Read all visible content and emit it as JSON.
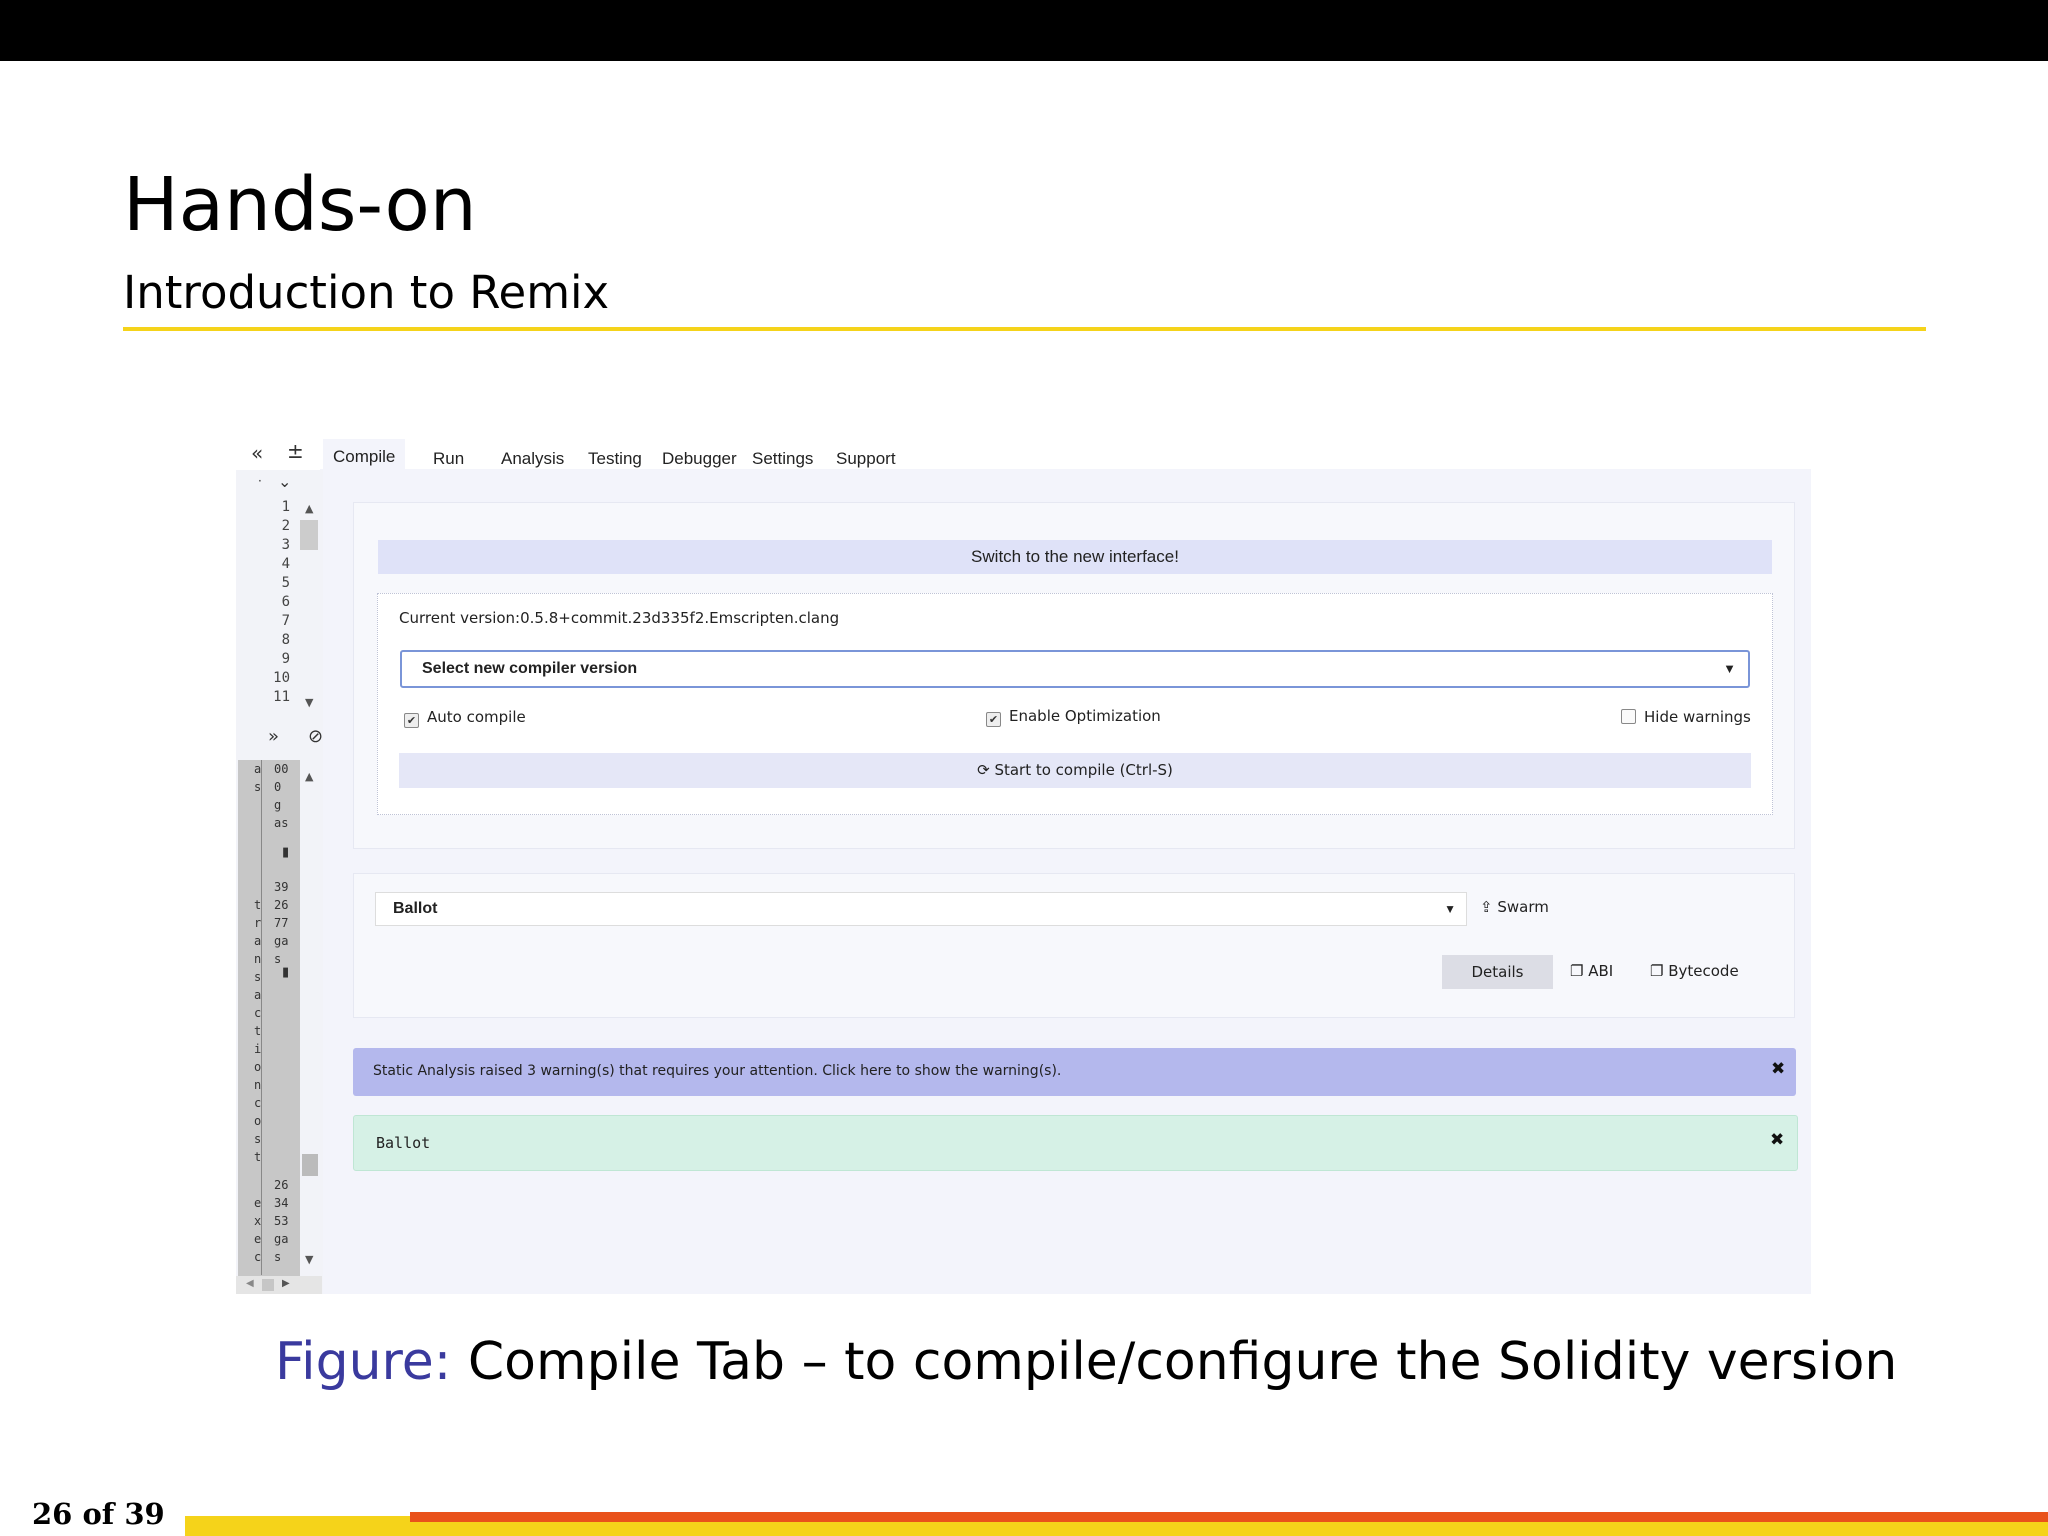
{
  "slide": {
    "title": "Hands-on",
    "subtitle": "Introduction to Remix",
    "caption_label": "Figure:",
    "caption_text": "Compile Tab – to compile/configure the Solidity version",
    "page_number": "26 of 39"
  },
  "remix": {
    "tabs": [
      "Compile",
      "Run",
      "Analysis",
      "Testing",
      "Debugger",
      "Settings",
      "Support"
    ],
    "line_numbers": [
      "1",
      "2",
      "3",
      "4",
      "5",
      "6",
      "7",
      "8",
      "9",
      "10",
      "11"
    ],
    "switch_interface_label": "Switch to the new interface!",
    "current_version": "Current version:0.5.8+commit.23d335f2.Emscripten.clang",
    "compiler_select_label": "Select new compiler version",
    "auto_compile_label": "Auto compile",
    "enable_optimization_label": "Enable Optimization",
    "hide_warnings_label": "Hide warnings",
    "auto_compile_checked": true,
    "enable_optimization_checked": true,
    "hide_warnings_checked": false,
    "compile_button_label": "Start to compile (Ctrl-S)",
    "contract_selected": "Ballot",
    "swarm_label": "Swarm",
    "details_label": "Details",
    "abi_label": "ABI",
    "bytecode_label": "Bytecode",
    "warning_message": "Static Analysis raised 3 warning(s) that requires your attention. Click here to show the warning(s).",
    "success_message": "Ballot",
    "terminal": {
      "col1_a": [
        "a",
        "s"
      ],
      "col2_a": [
        "00",
        "0",
        " g",
        "as"
      ],
      "col2_b": [
        "39",
        "26",
        "77",
        "ga",
        "s"
      ],
      "col1_b": [
        "t",
        "r",
        "a",
        "n",
        "s",
        "a",
        "c",
        "t",
        "i",
        "o",
        "n",
        "c",
        "o",
        "s",
        "t"
      ],
      "col2_c": [
        "26",
        "34",
        "53",
        "ga",
        "s"
      ],
      "col1_c": [
        "e",
        "x",
        "e",
        "c"
      ]
    }
  },
  "colors": {
    "accent_yellow": "#f5d31a",
    "accent_orange": "#e9521b",
    "figure_label": "#3a3a9e",
    "warning_bg": "#b4b8ed",
    "success_bg": "#d6f1e6"
  }
}
